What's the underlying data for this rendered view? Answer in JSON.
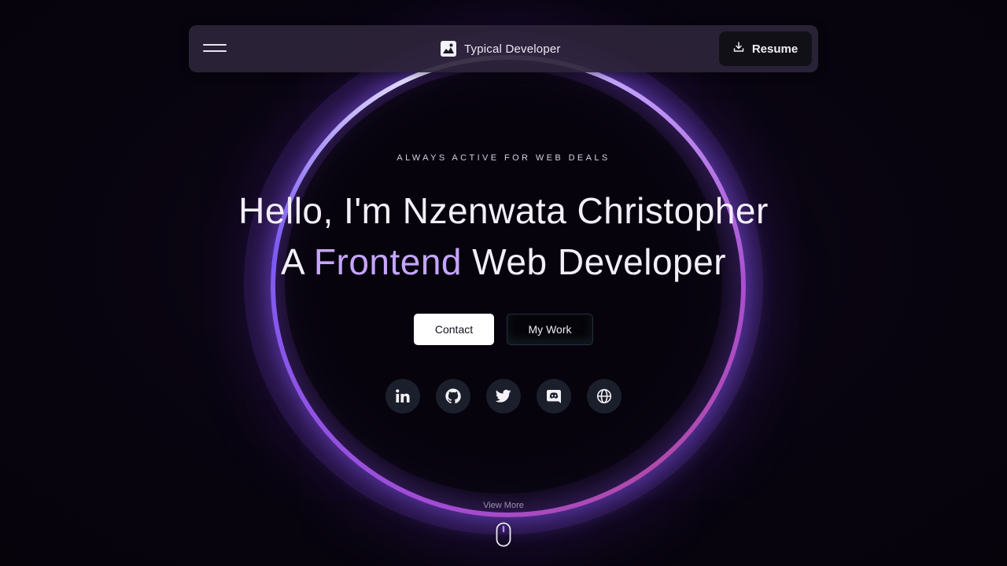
{
  "navbar": {
    "menu_icon": "hamburger-menu-icon",
    "brand": "Typical Developer",
    "brand_icon": "image-logo-icon",
    "resume_label": "Resume",
    "resume_icon": "download-icon"
  },
  "hero": {
    "eyebrow": "ALWAYS ACTIVE FOR WEB DEALS",
    "line1": "Hello, I'm Nzenwata Christopher",
    "line2_prefix": "A ",
    "line2_accent": "Frontend",
    "line2_suffix": " Web Developer",
    "accent_color": "#c5a5ff"
  },
  "buttons": {
    "contact": "Contact",
    "work": "My Work"
  },
  "socials": [
    {
      "icon": "linkedin-icon"
    },
    {
      "icon": "github-icon"
    },
    {
      "icon": "twitter-icon"
    },
    {
      "icon": "discord-icon"
    },
    {
      "icon": "globe-icon"
    }
  ],
  "scroll": {
    "label": "View More",
    "icon": "mouse-scroll-icon"
  },
  "colors": {
    "background": "#08040f",
    "navbar": "#2c243a",
    "ring_purple": "#a34bd6",
    "ring_highlight": "#ffffff"
  }
}
